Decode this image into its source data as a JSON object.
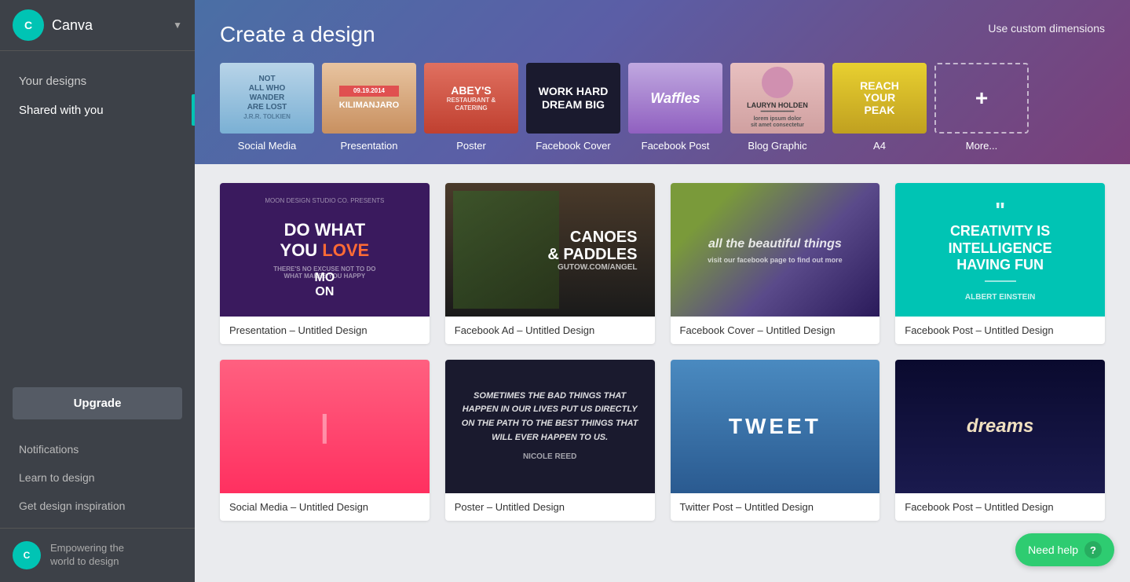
{
  "sidebar": {
    "logo_text": "C",
    "brand_name": "Canva",
    "nav_items": [
      {
        "id": "your-designs",
        "label": "Your designs",
        "active": false
      },
      {
        "id": "shared-with-you",
        "label": "Shared with you",
        "active": true
      }
    ],
    "upgrade_label": "Upgrade",
    "bottom_links": [
      {
        "id": "notifications",
        "label": "Notifications"
      },
      {
        "id": "learn-to-design",
        "label": "Learn to design"
      },
      {
        "id": "get-design-inspiration",
        "label": "Get design inspiration"
      }
    ],
    "footer_logo": "C",
    "footer_text_line1": "Empowering the",
    "footer_text_line2": "world to design"
  },
  "header": {
    "title": "Create a design",
    "custom_dimensions_label": "Use custom dimensions"
  },
  "design_types": [
    {
      "id": "social-media",
      "label": "Social Media"
    },
    {
      "id": "presentation",
      "label": "Presentation"
    },
    {
      "id": "poster",
      "label": "Poster"
    },
    {
      "id": "facebook-cover",
      "label": "Facebook Cover"
    },
    {
      "id": "facebook-post",
      "label": "Facebook Post"
    },
    {
      "id": "blog-graphic",
      "label": "Blog Graphic"
    },
    {
      "id": "a4",
      "label": "A4"
    },
    {
      "id": "more",
      "label": "More..."
    }
  ],
  "designs": [
    {
      "id": "presentation-untitled",
      "label": "Presentation – Untitled Design",
      "type": "presentation"
    },
    {
      "id": "facebook-ad-untitled",
      "label": "Facebook Ad – Untitled Design",
      "type": "facebook-ad"
    },
    {
      "id": "facebook-cover-untitled",
      "label": "Facebook Cover – Untitled Design",
      "type": "facebook-cover"
    },
    {
      "id": "facebook-post-untitled",
      "label": "Facebook Post – Untitled Design",
      "type": "facebook-post"
    },
    {
      "id": "pink-untitled",
      "label": "Social Media – Untitled Design",
      "type": "pink"
    },
    {
      "id": "dark-quote-untitled",
      "label": "Poster – Untitled Design",
      "type": "dark-quote"
    },
    {
      "id": "tweet-untitled",
      "label": "Twitter Post – Untitled Design",
      "type": "tweet"
    },
    {
      "id": "dreams-untitled",
      "label": "Facebook Post – Untitled Design",
      "type": "dreams"
    }
  ],
  "need_help": {
    "label": "Need help",
    "icon": "?"
  }
}
